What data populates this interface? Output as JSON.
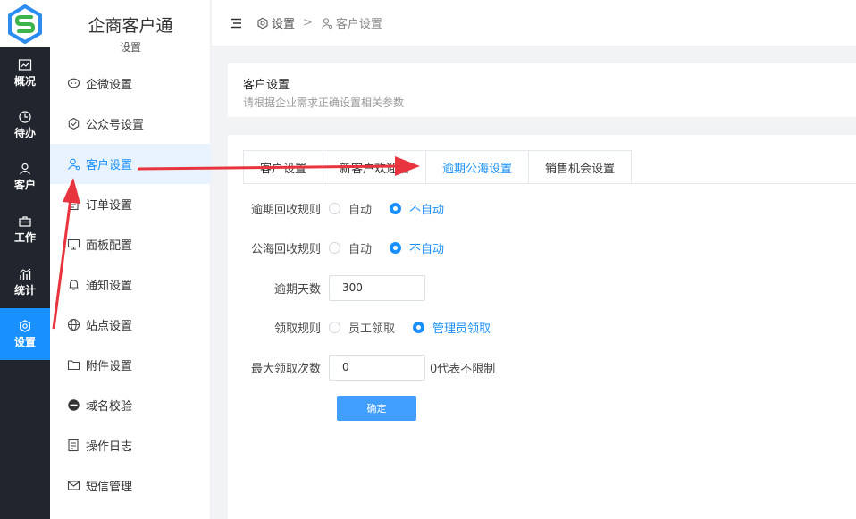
{
  "app": {
    "brand": "企商客户通",
    "section": "设置"
  },
  "rail": [
    {
      "label": "概况",
      "icon": "chart-icon"
    },
    {
      "label": "待办",
      "icon": "clock-icon"
    },
    {
      "label": "客户",
      "icon": "user-icon"
    },
    {
      "label": "工作",
      "icon": "briefcase-icon"
    },
    {
      "label": "统计",
      "icon": "stats-icon"
    },
    {
      "label": "设置",
      "icon": "gear-icon",
      "active": true
    }
  ],
  "submenu": [
    {
      "label": "企微设置",
      "icon": "wecom-icon"
    },
    {
      "label": "公众号设置",
      "icon": "official-account-icon"
    },
    {
      "label": "客户设置",
      "icon": "customer-icon",
      "active": true
    },
    {
      "label": "订单设置",
      "icon": "order-icon"
    },
    {
      "label": "面板配置",
      "icon": "panel-icon"
    },
    {
      "label": "通知设置",
      "icon": "bell-icon"
    },
    {
      "label": "站点设置",
      "icon": "globe-icon"
    },
    {
      "label": "附件设置",
      "icon": "folder-icon"
    },
    {
      "label": "域名校验",
      "icon": "domain-icon"
    },
    {
      "label": "操作日志",
      "icon": "log-icon"
    },
    {
      "label": "短信管理",
      "icon": "mail-icon"
    }
  ],
  "breadcrumb": {
    "root": "设置",
    "separator": ">",
    "current": "客户设置"
  },
  "page_header": {
    "title": "客户设置",
    "description": "请根据企业需求正确设置相关参数"
  },
  "tabs": [
    {
      "label": "客户设置"
    },
    {
      "label": "新客户欢迎语"
    },
    {
      "label": "逾期公海设置",
      "active": true
    },
    {
      "label": "销售机会设置"
    }
  ],
  "form": {
    "overdue_rule": {
      "label": "逾期回收规则",
      "options": [
        "自动",
        "不自动"
      ],
      "selected": 1
    },
    "pool_rule": {
      "label": "公海回收规则",
      "options": [
        "自动",
        "不自动"
      ],
      "selected": 1
    },
    "overdue_days": {
      "label": "逾期天数",
      "value": "300"
    },
    "claim_rule": {
      "label": "领取规则",
      "options": [
        "员工领取",
        "管理员领取"
      ],
      "selected": 1
    },
    "max_claims": {
      "label": "最大领取次数",
      "value": "0",
      "hint": "0代表不限制"
    },
    "submit_label": "确定"
  },
  "colors": {
    "primary": "#1890ff",
    "button": "#409eff",
    "rail_bg": "#21262e",
    "annotation_arrow": "#e8343f"
  }
}
